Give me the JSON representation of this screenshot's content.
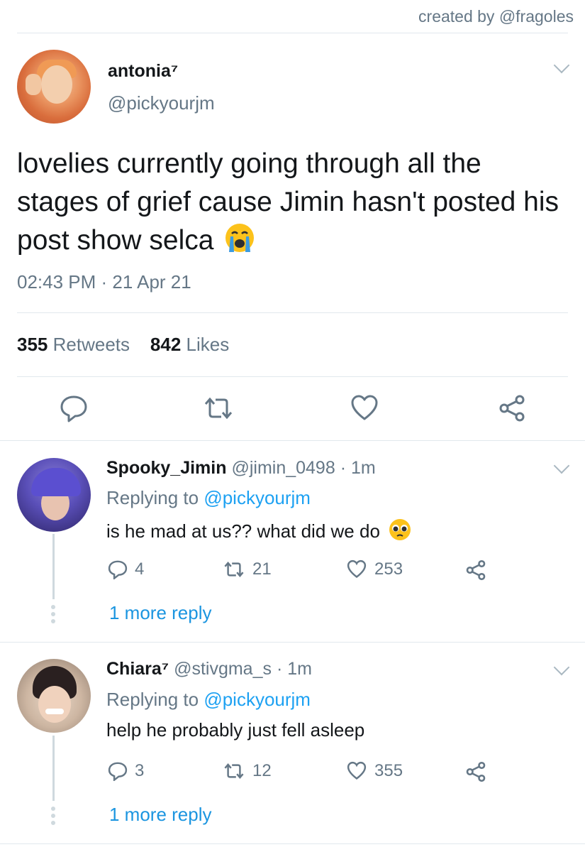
{
  "credit": "created by @fragoles",
  "tweet": {
    "name": "antonia⁷",
    "handle": "@pickyourjm",
    "text": "lovelies currently going through all the stages of grief cause Jimin hasn't posted his post show selca",
    "emoji": "crying-face-emoji",
    "timestamp": "02:43 PM · 21 Apr 21",
    "retweets_count": "355",
    "retweets_label": "Retweets",
    "likes_count": "842",
    "likes_label": "Likes"
  },
  "replies": [
    {
      "name": "Spooky_Jimin",
      "handle": "@jimin_0498",
      "time": "· 1m",
      "replying_prefix": "Replying to",
      "replying_to": "@pickyourjm",
      "text": "is he mad at us?? what did we do",
      "emoji": "pleading-face-emoji",
      "replies": "4",
      "retweets": "21",
      "likes": "253",
      "more": "1 more reply"
    },
    {
      "name": "Chiara⁷",
      "handle": "@stivgma_s",
      "time": "· 1m",
      "replying_prefix": "Replying to",
      "replying_to": "@pickyourjm",
      "text": "help he probably just fell asleep",
      "replies": "3",
      "retweets": "12",
      "likes": "355",
      "more": "1 more reply"
    }
  ],
  "colors": {
    "link": "#1da1f2",
    "muted": "#657786",
    "divider": "#e1e8ed"
  }
}
